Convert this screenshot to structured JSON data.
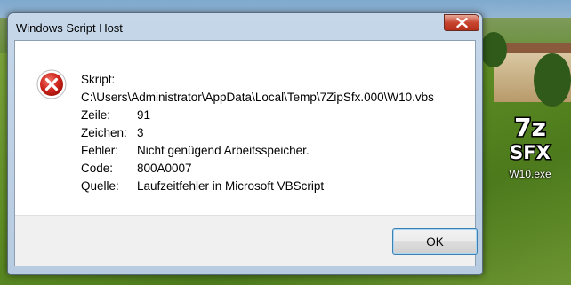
{
  "desktop": {
    "icon_label": "W10.exe",
    "icon_logo_top": "7z",
    "icon_logo_bottom": "SFX"
  },
  "dialog": {
    "title": "Windows Script Host",
    "close_icon": "close-icon",
    "error_icon": "error-icon",
    "script_label": "Skript:",
    "script_path": "C:\\Users\\Administrator\\AppData\\Local\\Temp\\7ZipSfx.000\\W10.vbs",
    "rows": [
      {
        "label": "Zeile:",
        "value": "91"
      },
      {
        "label": "Zeichen:",
        "value": "3"
      },
      {
        "label": "Fehler:",
        "value": "Nicht genügend Arbeitsspeicher."
      },
      {
        "label": "Code:",
        "value": "800A0007"
      },
      {
        "label": "Quelle:",
        "value": "Laufzeitfehler in Microsoft VBScript"
      }
    ],
    "ok_label": "OK"
  },
  "colors": {
    "accent": "#3c7fb1",
    "close_red": "#c7452f",
    "error_red": "#d0281e"
  }
}
